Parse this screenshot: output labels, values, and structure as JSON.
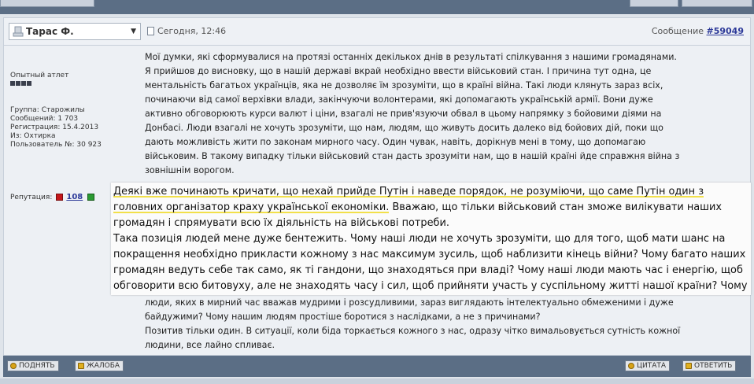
{
  "post": {
    "author": "Тарас Ф.",
    "date": "Сегодня, 12:46",
    "number_label": "Сообщение",
    "number": "#59049"
  },
  "profile": {
    "rank": "Опытный атлет",
    "stats": [
      "Группа: Старожилы",
      "Сообщений: 1 703",
      "Регистрация: 15.4.2013",
      "Из: Охтирка",
      "Пользователь №: 30 923"
    ],
    "reputation_label": "Репутация:",
    "reputation_value": "108"
  },
  "text": {
    "lines_top": [
      "Мої думки, які сформувалися на протязі останніх декількох днів в результаті спілкування з нашими громадянами.",
      "Я прийшов до висновку, що в нашій державі вкрай необхідно ввести військовий стан. І причина тут одна, це",
      "ментальність багатьох українців, яка не дозволяє їм зрозуміти, що в країні війна. Такі люди клянуть зараз всіх,",
      "починаючи від самої верхівки влади, закінчуючи волонтерами, які допомагають українській армії. Вони дуже",
      "активно обговорюють курси валют і ціни, взагалі не прив'язуючи обвал в цьому напрямку з бойовими діями на",
      "Донбасі. Люди взагалі не хочуть зрозуміти, що нам, людям, що живуть досить далеко від бойових дій, поки що",
      "дають можливість жити по законам мирного часу. Один чувак, навіть, дорікнув мені в тому, що допомагаю",
      "військовим. В такому випадку тільки військовий стан дасть зрозуміти нам, що в нашій країні йде справжня війна з",
      "зовнішнім ворогом."
    ],
    "zoom_lines": [
      "Деякі вже починають кричати, що нехай прийде Путін і наведе порядок, не розуміючи, що саме Путін один з",
      "головних організатор краху української економіки.",
      " Вважаю, що тільки військовий стан зможе вилікувати наших",
      "громадян і спрямувати всю їх діяльність на військові потреби.",
      "Така позиція людей мене дуже бентежить. Чому наші люди не хочуть зрозуміти, що для того, щоб мати шанс на",
      "покращення необхідно прикласти кожному з нас максимум зусиль, щоб наблизити кінець війни? Чому багато наших",
      "громадян ведуть себе так само, як ті гандони, що знаходяться при владі? Чому наші люди мають час і енергію, щоб",
      "обговорити всю битовуху, але не знаходять часу і сил, щоб прийняти участь у суспільному житті нашої країни? Чому"
    ],
    "lines_bottom": [
      "люди, яких в мирний час вважав мудрими і розсудливими, зараз виглядають інтелектуально обмеженими і дуже",
      "байдужими? Чому нашим людям простіше боротися з наслідками, а не з причинами?",
      "Позитив тільки один. В ситуації, коли біда торкається кожного з нас, одразу чітко вимальовується сутність кожної",
      "людини, все лайно спливає."
    ]
  },
  "buttons": {
    "raise": "ПОДНЯТЬ",
    "report": "ЖАЛОБА",
    "quote": "ЦИТАТА",
    "reply": "ОТВЕТИТЬ"
  },
  "colors": {
    "frame": "#5b6e85",
    "highlight": "#f2e04a",
    "rep_minus": "#c4171a",
    "rep_plus": "#2b9a32"
  }
}
